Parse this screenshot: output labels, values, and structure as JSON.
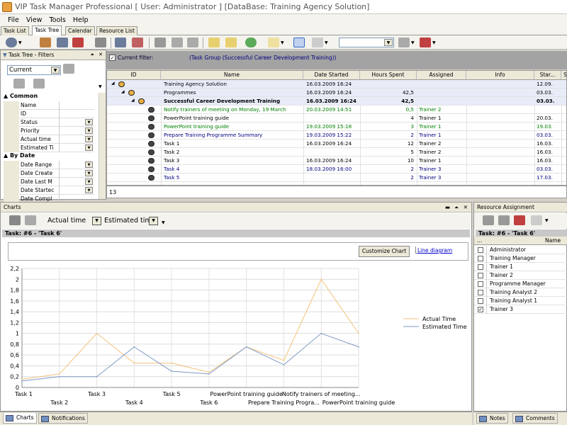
{
  "app": {
    "title": "VIP Task Manager Professional [ User: Administrator ] [DataBase: Training Agency Solution]"
  },
  "menu": [
    "File",
    "View",
    "Tools",
    "Help"
  ],
  "tabs": [
    "Task List",
    "Task Tree",
    "Calendar",
    "Resource List"
  ],
  "active_tab": "Task Tree",
  "filter_pane": {
    "title": "Task Tree - Filters",
    "view_combo": "Current",
    "sections": [
      {
        "label": "Common",
        "items": [
          {
            "label": "Name",
            "dropdown": false
          },
          {
            "label": "ID",
            "dropdown": false
          },
          {
            "label": "Status",
            "dropdown": true
          },
          {
            "label": "Priority",
            "dropdown": true
          },
          {
            "label": "Actual time",
            "dropdown": true
          },
          {
            "label": "Estimated Ti",
            "dropdown": true
          }
        ]
      },
      {
        "label": "By Date",
        "items": [
          {
            "label": "Date Range",
            "dropdown": true
          },
          {
            "label": "Date Create",
            "dropdown": true
          },
          {
            "label": "Date Last M",
            "dropdown": true
          },
          {
            "label": "Date Startec",
            "dropdown": true
          },
          {
            "label": "Date Compl",
            "dropdown": false
          }
        ]
      }
    ]
  },
  "current_filter": {
    "checkbox_checked": true,
    "label": "Current filter:",
    "expression": "(Task Group  (Successful Career Development Training))"
  },
  "grid": {
    "columns": [
      "ID",
      "Name",
      "Date Started",
      "Hours Spent",
      "Assigned",
      "Info",
      "Star...",
      "S"
    ],
    "rows": [
      {
        "name": "Training Agency Solution",
        "date": "16.03.2009 16:24",
        "hours": "",
        "assigned": "",
        "start": "12.09.",
        "color": "#000000",
        "bold": false,
        "level": 0
      },
      {
        "name": "Programmes",
        "date": "16.03.2009 16:24",
        "hours": "42,5",
        "assigned": "",
        "start": "03.03.",
        "color": "#000000",
        "bold": false,
        "level": 1
      },
      {
        "name": "Successful Career Development Training",
        "date": "16.03.2009 16:24",
        "hours": "42,5",
        "assigned": "",
        "start": "03.03.",
        "color": "#000000",
        "bold": true,
        "level": 2
      },
      {
        "name": "Notify trainers of meeting on Monday, 19 March",
        "date": "20.03.2009 14:51",
        "hours": "0,5",
        "assigned": "Trainer 2",
        "start": "",
        "color": "#008000",
        "bold": false,
        "level": 3
      },
      {
        "name": "PowerPoint training guide",
        "date": "",
        "hours": "4",
        "assigned": "Trainer 1",
        "start": "20.03.",
        "color": "#000000",
        "bold": false,
        "level": 3
      },
      {
        "name": "PowerPoint training guide",
        "date": "19.03.2009 15:18",
        "hours": "3",
        "assigned": "Trainer 1",
        "start": "19.03.",
        "color": "#008000",
        "bold": false,
        "level": 3
      },
      {
        "name": "Prepare Training Programme Summary",
        "date": "19.03.2009 15:22",
        "hours": "2",
        "assigned": "Trainer 1",
        "start": "03.03.",
        "color": "#000080",
        "bold": false,
        "level": 3
      },
      {
        "name": "Task 1",
        "date": "16.03.2009 16:24",
        "hours": "12",
        "assigned": "Trainer 2",
        "start": "16.03.",
        "color": "#000000",
        "bold": false,
        "level": 3
      },
      {
        "name": "Task 2",
        "date": "",
        "hours": "5",
        "assigned": "Trainer 2",
        "start": "16.03.",
        "color": "#000000",
        "bold": false,
        "level": 3
      },
      {
        "name": "Task 3",
        "date": "16.03.2009 16:24",
        "hours": "10",
        "assigned": "Trainer 1",
        "start": "16.03.",
        "color": "#000000",
        "bold": false,
        "level": 3
      },
      {
        "name": "Task 4",
        "date": "18.03.2009 16:00",
        "hours": "2",
        "assigned": "Trainer 3",
        "start": "03.03.",
        "color": "#000080",
        "bold": false,
        "level": 3
      },
      {
        "name": "Task 5",
        "date": "",
        "hours": "2",
        "assigned": "Trainer 3",
        "start": "17.03.",
        "color": "#000080",
        "bold": false,
        "level": 3
      }
    ],
    "footer_count": "13"
  },
  "charts_pane": {
    "title": "Charts",
    "actual_label": "Actual time",
    "estimated_label": "Estimated tim",
    "task_title": "Task: #6 - 'Task 6'",
    "customize_button": "Customize Chart",
    "line_diagram_link": "Line diagram",
    "colors": {
      "actual": "#f4c27a",
      "estimated": "#7f9bc4"
    }
  },
  "chart_data": {
    "type": "line",
    "categories": [
      "Task 1",
      "Task 2",
      "Task 3",
      "Task 4",
      "Task 5",
      "Task 6",
      "PowerPoint training guide",
      "Prepare Training Progra...",
      "Notify trainers of meeting...",
      "PowerPoint training guide"
    ],
    "series": [
      {
        "name": "Actual Time",
        "values": [
          0.15,
          0.25,
          1.0,
          0.45,
          0.45,
          0.28,
          0.75,
          0.5,
          2.0,
          1.0
        ]
      },
      {
        "name": "Estimated Time",
        "values": [
          0.12,
          0.2,
          0.2,
          0.75,
          0.3,
          0.25,
          0.75,
          0.42,
          1.0,
          0.75
        ]
      }
    ],
    "ylim": [
      0,
      2.2
    ],
    "yticks": [
      "0",
      "0,2",
      "0,4",
      "0,6",
      "0,8",
      "1",
      "1,2",
      "1,4",
      "1,6",
      "1,8",
      "2",
      "2,2"
    ],
    "grid": true,
    "legend": "right"
  },
  "resource_pane": {
    "title": "Resource Assignment",
    "task_title": "Task: #6 - 'Task 6'",
    "column_name": "Name",
    "column_dots": "...",
    "resources": [
      {
        "name": "Administrator",
        "checked": false
      },
      {
        "name": "Training Manager",
        "checked": false
      },
      {
        "name": "Trainer 1",
        "checked": false
      },
      {
        "name": "Trainer 2",
        "checked": false
      },
      {
        "name": "Programme Manager",
        "checked": false
      },
      {
        "name": "Training Analyst 2",
        "checked": false
      },
      {
        "name": "Training Analyst 1",
        "checked": false
      },
      {
        "name": "Trainer 3",
        "checked": true
      }
    ]
  },
  "bottom_tabs": [
    "Charts",
    "Notifications"
  ],
  "bottom_tabs_right": [
    "Notes",
    "Comments"
  ]
}
